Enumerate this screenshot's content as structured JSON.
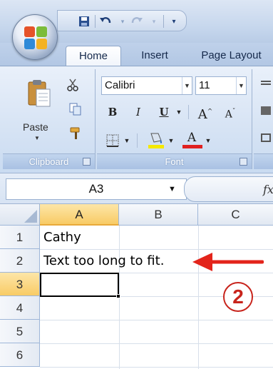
{
  "tabs": [
    {
      "label": "Home",
      "active": true
    },
    {
      "label": "Insert",
      "active": false
    },
    {
      "label": "Page Layout",
      "active": false
    }
  ],
  "ribbon": {
    "clipboard": {
      "label": "Clipboard",
      "paste_label": "Paste"
    },
    "font": {
      "label": "Font",
      "font_name": "Calibri",
      "font_size": "11",
      "bold": "B",
      "italic": "I",
      "underline": "U",
      "grow": "A",
      "shrink": "A",
      "font_color_glyph": "A"
    }
  },
  "formula_bar": {
    "name_box": "A3",
    "fx_label": "fx"
  },
  "sheet": {
    "columns": [
      "A",
      "B",
      "C"
    ],
    "rows": [
      "1",
      "2",
      "3",
      "4",
      "5",
      "6"
    ],
    "cells": {
      "A1": "Cathy",
      "A2": "Text too long to fit.",
      "A3": ""
    },
    "active_cell": "A3"
  },
  "annotation": {
    "step_number": "2",
    "arrow_color": "#e3241b"
  },
  "colors": {
    "ribbon_blue": "#c9dbf1",
    "selected_header": "#f8cb65",
    "font_color_bar": "#e02020",
    "highlight_bar": "#f5e900"
  }
}
